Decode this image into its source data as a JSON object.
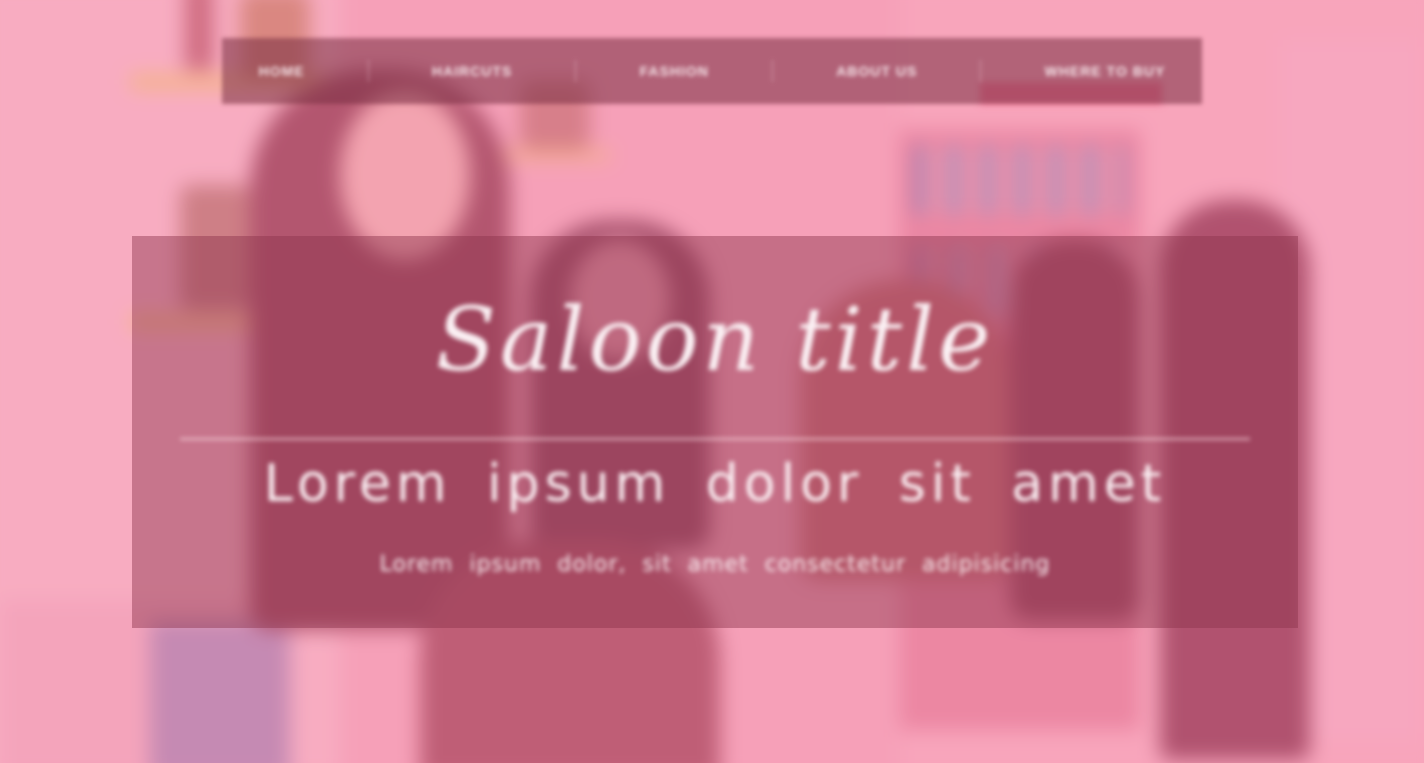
{
  "nav": {
    "items": [
      {
        "label": "Home"
      },
      {
        "label": "Haircuts"
      },
      {
        "label": "Fashion"
      },
      {
        "label": "About Us"
      },
      {
        "label": "Where to Buy"
      }
    ],
    "active_accent": "#f05078"
  },
  "hero": {
    "title": "Saloon title",
    "subtitle": "Lorem ipsum dolor sit amet",
    "caption": "Lorem ipsum dolor, sit amet consectetur adipisicing"
  },
  "colors": {
    "overlay": "#fa82a0",
    "panel": "#8c324b",
    "text": "#fbf1f4"
  }
}
